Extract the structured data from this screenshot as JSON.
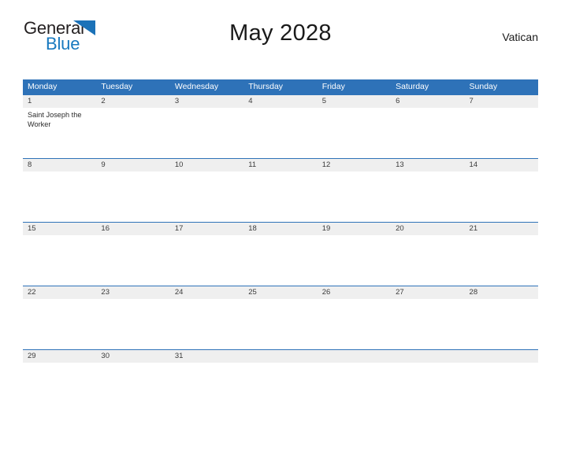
{
  "brand": {
    "name_part1": "General",
    "name_part2": "Blue",
    "flag_icon": "blue-triangle-flag-icon",
    "color_dark": "#231f20",
    "color_blue": "#1879bf"
  },
  "header": {
    "title": "May 2028",
    "region": "Vatican"
  },
  "calendar": {
    "header_bg": "#2e72b8",
    "date_band_bg": "#efefef",
    "weekdays": [
      "Monday",
      "Tuesday",
      "Wednesday",
      "Thursday",
      "Friday",
      "Saturday",
      "Sunday"
    ],
    "weeks": [
      {
        "days": [
          {
            "date": "1",
            "event": "Saint Joseph the Worker"
          },
          {
            "date": "2",
            "event": ""
          },
          {
            "date": "3",
            "event": ""
          },
          {
            "date": "4",
            "event": ""
          },
          {
            "date": "5",
            "event": ""
          },
          {
            "date": "6",
            "event": ""
          },
          {
            "date": "7",
            "event": ""
          }
        ]
      },
      {
        "days": [
          {
            "date": "8",
            "event": ""
          },
          {
            "date": "9",
            "event": ""
          },
          {
            "date": "10",
            "event": ""
          },
          {
            "date": "11",
            "event": ""
          },
          {
            "date": "12",
            "event": ""
          },
          {
            "date": "13",
            "event": ""
          },
          {
            "date": "14",
            "event": ""
          }
        ]
      },
      {
        "days": [
          {
            "date": "15",
            "event": ""
          },
          {
            "date": "16",
            "event": ""
          },
          {
            "date": "17",
            "event": ""
          },
          {
            "date": "18",
            "event": ""
          },
          {
            "date": "19",
            "event": ""
          },
          {
            "date": "20",
            "event": ""
          },
          {
            "date": "21",
            "event": ""
          }
        ]
      },
      {
        "days": [
          {
            "date": "22",
            "event": ""
          },
          {
            "date": "23",
            "event": ""
          },
          {
            "date": "24",
            "event": ""
          },
          {
            "date": "25",
            "event": ""
          },
          {
            "date": "26",
            "event": ""
          },
          {
            "date": "27",
            "event": ""
          },
          {
            "date": "28",
            "event": ""
          }
        ]
      },
      {
        "days": [
          {
            "date": "29",
            "event": ""
          },
          {
            "date": "30",
            "event": ""
          },
          {
            "date": "31",
            "event": ""
          },
          {
            "date": "",
            "event": ""
          },
          {
            "date": "",
            "event": ""
          },
          {
            "date": "",
            "event": ""
          },
          {
            "date": "",
            "event": ""
          }
        ]
      }
    ]
  }
}
